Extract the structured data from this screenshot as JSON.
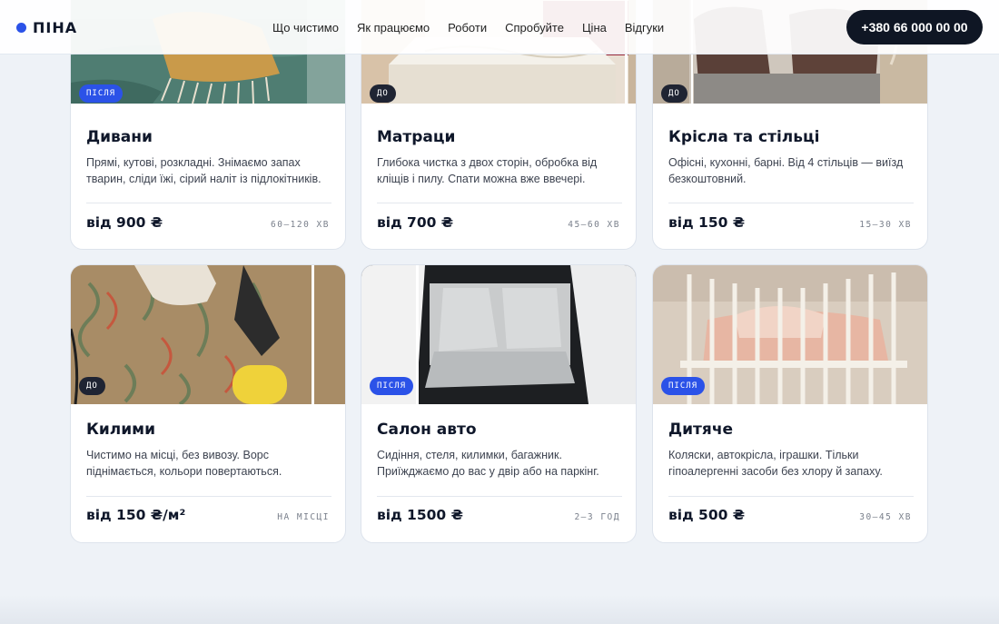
{
  "header": {
    "brand": "ПІНА",
    "nav": [
      "Що чистимо",
      "Як працюємо",
      "Роботи",
      "Спробуйте",
      "Ціна",
      "Відгуки"
    ],
    "phone": "+380 66 000 00 00"
  },
  "cards": [
    {
      "badge": "ПІСЛЯ",
      "title": "Дивани",
      "desc": "Прямі, кутові, розкладні. Знімаємо запах тварин, сліди їжі, сірий наліт із підлокітників.",
      "price": "від 900 ₴",
      "time": "60–120 ХВ"
    },
    {
      "badge": "ДО",
      "title": "Матраци",
      "desc": "Глибока чистка з двох сторін, обробка від кліщів і пилу. Спати можна вже ввечері.",
      "price": "від 700 ₴",
      "time": "45–60 ХВ"
    },
    {
      "badge": "ДО",
      "title": "Крісла та стільці",
      "desc": "Офісні, кухонні, барні. Від 4 стільців — виїзд безкоштовний.",
      "price": "від 150 ₴",
      "time": "15–30 ХВ"
    },
    {
      "badge": "ДО",
      "title": "Килими",
      "desc": "Чистимо на місці, без вивозу. Ворс піднімається, кольори повертаються.",
      "price": "від 150 ₴/м²",
      "time": "НА МІСЦІ"
    },
    {
      "badge": "ПІСЛЯ",
      "title": "Салон авто",
      "desc": "Сидіння, стеля, килимки, багажник. Приїжджаємо до вас у двір або на паркінг.",
      "price": "від 1500 ₴",
      "time": "2–3 ГОД"
    },
    {
      "badge": "ПІСЛЯ",
      "title": "Дитяче",
      "desc": "Коляски, автокрісла, іграшки. Тільки гіпоалергенні засоби без хлору й запаху.",
      "price": "від 500 ₴",
      "time": "30–45 ХВ"
    }
  ]
}
